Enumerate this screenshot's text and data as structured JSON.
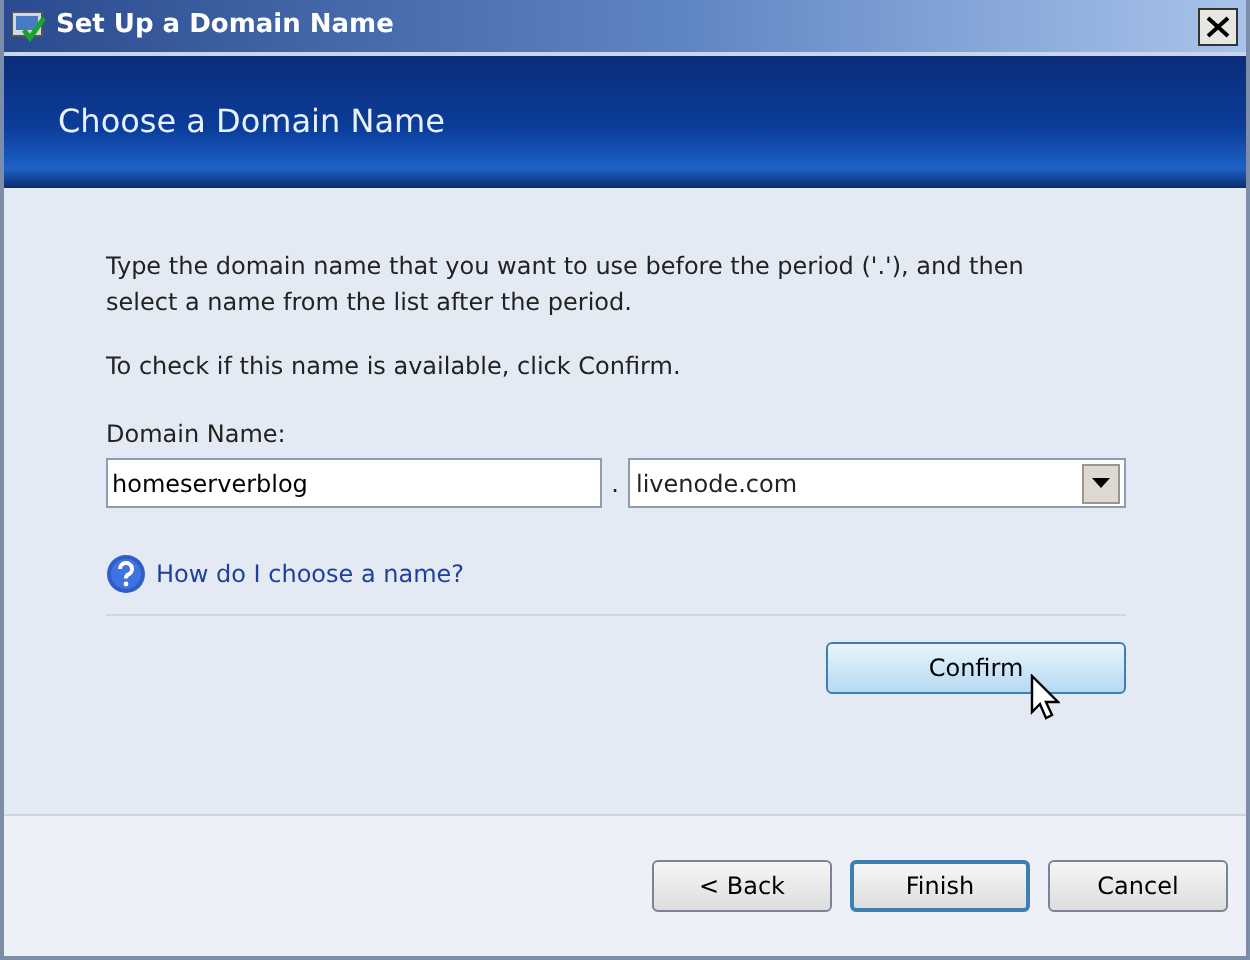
{
  "window": {
    "title": "Set Up a Domain Name"
  },
  "header": {
    "title": "Choose a Domain Name"
  },
  "instructions": [
    "Type the domain name that you want to use before the period ('.'), and then select a name from the list after the period.",
    "To check if this name is available, click Confirm."
  ],
  "domain": {
    "label": "Domain Name:",
    "value": "homeserverblog",
    "separator": ".",
    "suffix": "livenode.com"
  },
  "help_link": "How do I choose a name?",
  "confirm_button": {
    "label": "Confirm",
    "hovered": true
  },
  "buttons": [
    {
      "label": "< Back",
      "default": false
    },
    {
      "label": "Finish",
      "default": true
    },
    {
      "label": "Cancel",
      "default": false
    }
  ]
}
